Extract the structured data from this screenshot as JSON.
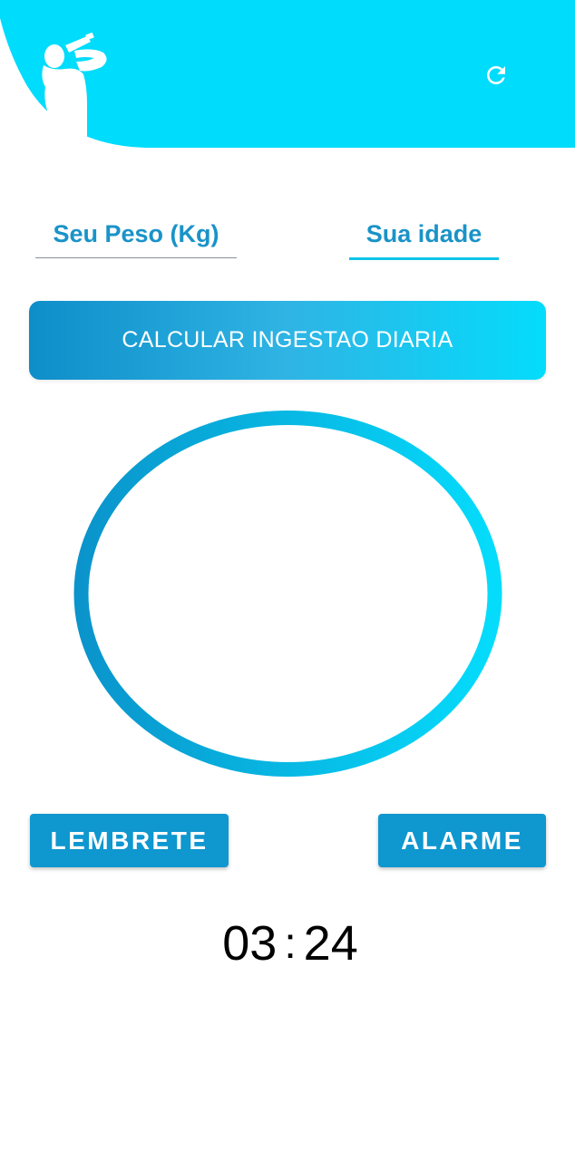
{
  "colors": {
    "header": "#00dcfc",
    "accent": "#1a93c8",
    "button": "#0f97cf",
    "ring_start": "#0a94cb",
    "ring_end": "#05dcfc"
  },
  "header": {
    "logo_icon": "person-drinking-icon",
    "refresh_icon": "refresh-icon"
  },
  "form": {
    "weight_placeholder": "Seu Peso (Kg)",
    "age_placeholder": "Sua idade"
  },
  "calc_button_label": "CALCULAR INGESTAO DIARIA",
  "buttons": {
    "reminder_label": "LEMBRETE",
    "alarm_label": "ALARME"
  },
  "timer": {
    "hours": "03",
    "separator": ":",
    "minutes": "24"
  }
}
